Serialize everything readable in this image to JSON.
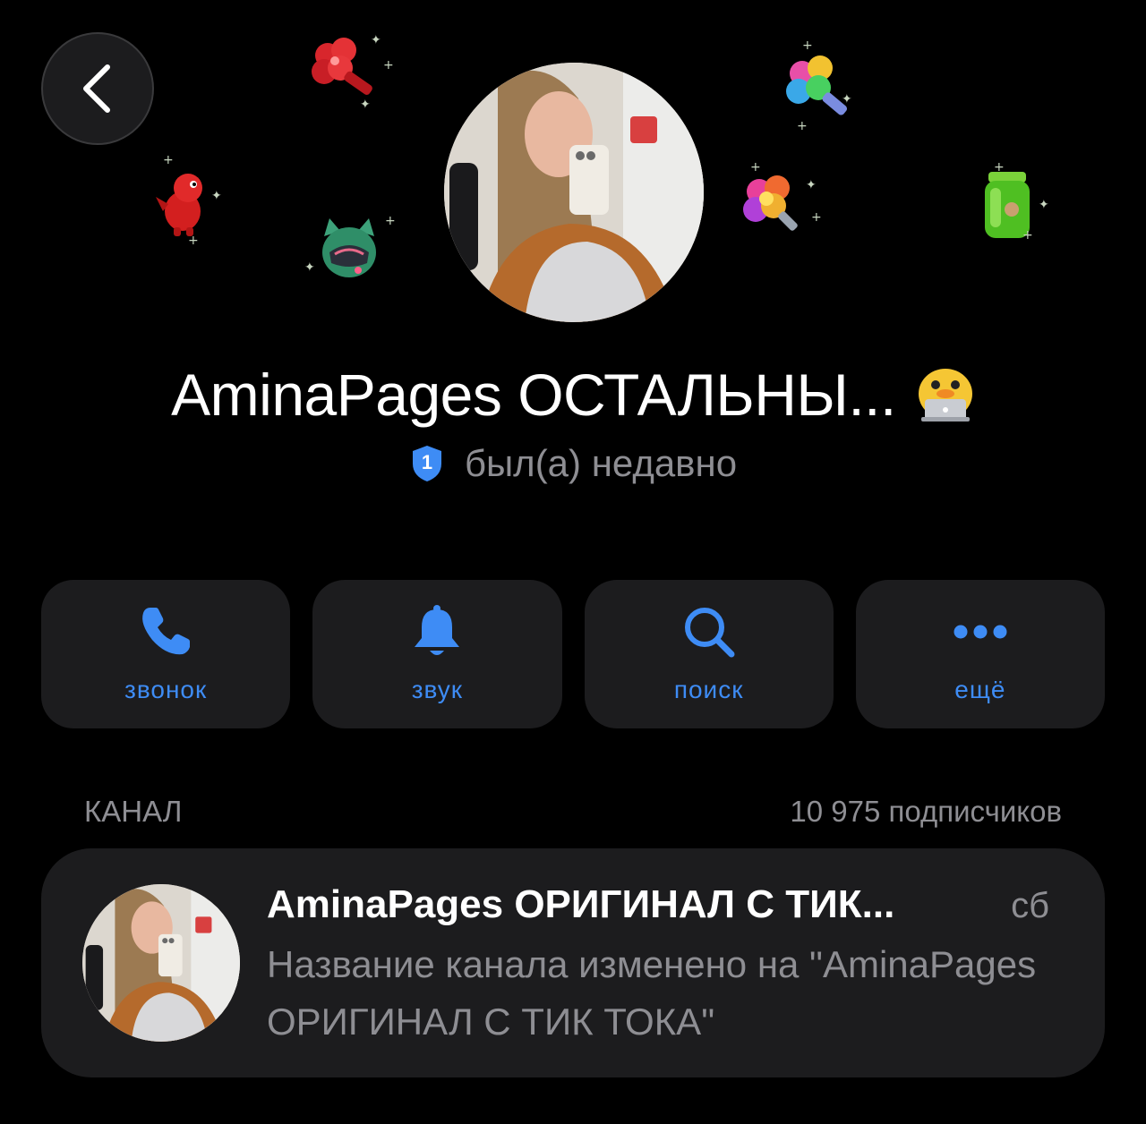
{
  "header": {
    "back_icon": "chevron-left-icon",
    "gift_stickers": [
      "red-clover-lollipop",
      "rainbow-clover-lollipop",
      "red-dragon",
      "cat-helmet",
      "flower-lollipop",
      "green-jar"
    ]
  },
  "profile": {
    "name": "AminaPages ОСТАЛЬНЫ...",
    "emoji_status": "duck-with-laptop-emoji",
    "status_badge": "1",
    "status_text": "был(а) недавно"
  },
  "actions": [
    {
      "label": "звонок",
      "icon": "phone-icon"
    },
    {
      "label": "звук",
      "icon": "bell-icon"
    },
    {
      "label": "поиск",
      "icon": "search-icon"
    },
    {
      "label": "ещё",
      "icon": "more-icon"
    }
  ],
  "channel_section": {
    "header_label": "КАНАЛ",
    "subscribers": "10 975 подписчиков"
  },
  "channel": {
    "title": "AminaPages ОРИГИНАЛ С ТИК...",
    "time": "сб",
    "message": "Название канала изменено на \"AminaPages ОРИГИНАЛ С ТИК ТОКА\""
  },
  "colors": {
    "background": "#000000",
    "card": "#1c1c1e",
    "accent": "#3e8cf5",
    "secondary_text": "#8e8e93"
  }
}
